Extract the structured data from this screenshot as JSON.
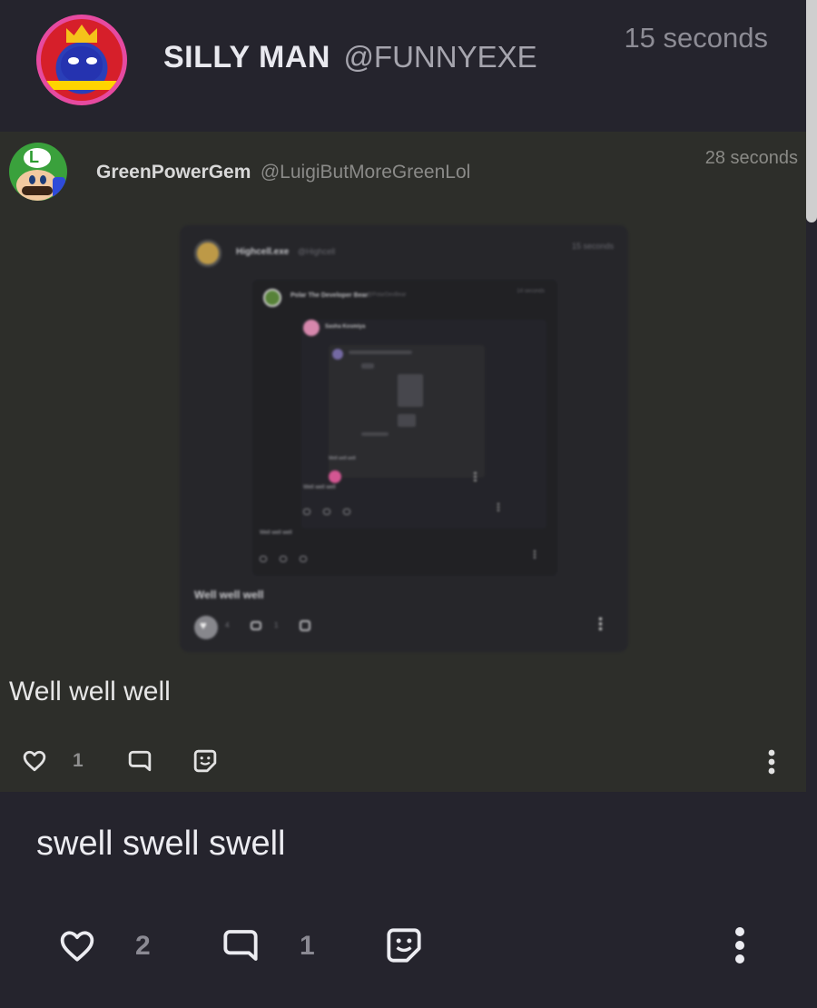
{
  "post": {
    "author_name": "SILLY MAN",
    "author_handle": "@FUNNYEXE",
    "time": "15 seconds",
    "body": "swell swell swell",
    "likes": "2",
    "comments": "1",
    "icons": [
      "heart-icon",
      "comment-icon",
      "sticker-icon",
      "more-vertical-icon"
    ]
  },
  "quoted": {
    "author_name": "GreenPowerGem",
    "author_handle": "@LuigiButMoreGreenLol",
    "time": "28 seconds",
    "body": "Well well well",
    "likes": "1",
    "nested": {
      "author_name": "Highcell.exe",
      "author_handle": "@Highcell",
      "time": "15 seconds",
      "body": "Well well well",
      "likes": "4",
      "comments": "1",
      "inner": {
        "author_name": "Polar The Developer Bear",
        "author_handle": "@PolarDevBear",
        "time": "14 seconds",
        "body": "Well well well",
        "deeper_author": "Sasha Kosmiya",
        "deeper_body": "Well well well",
        "deepest_body": "Well well well"
      }
    }
  },
  "colors": {
    "background": "#25242d",
    "quoted_background": "#2d2e2a",
    "avatar_ring": "#e64aa0",
    "accent_pink": "#e25a9b"
  }
}
